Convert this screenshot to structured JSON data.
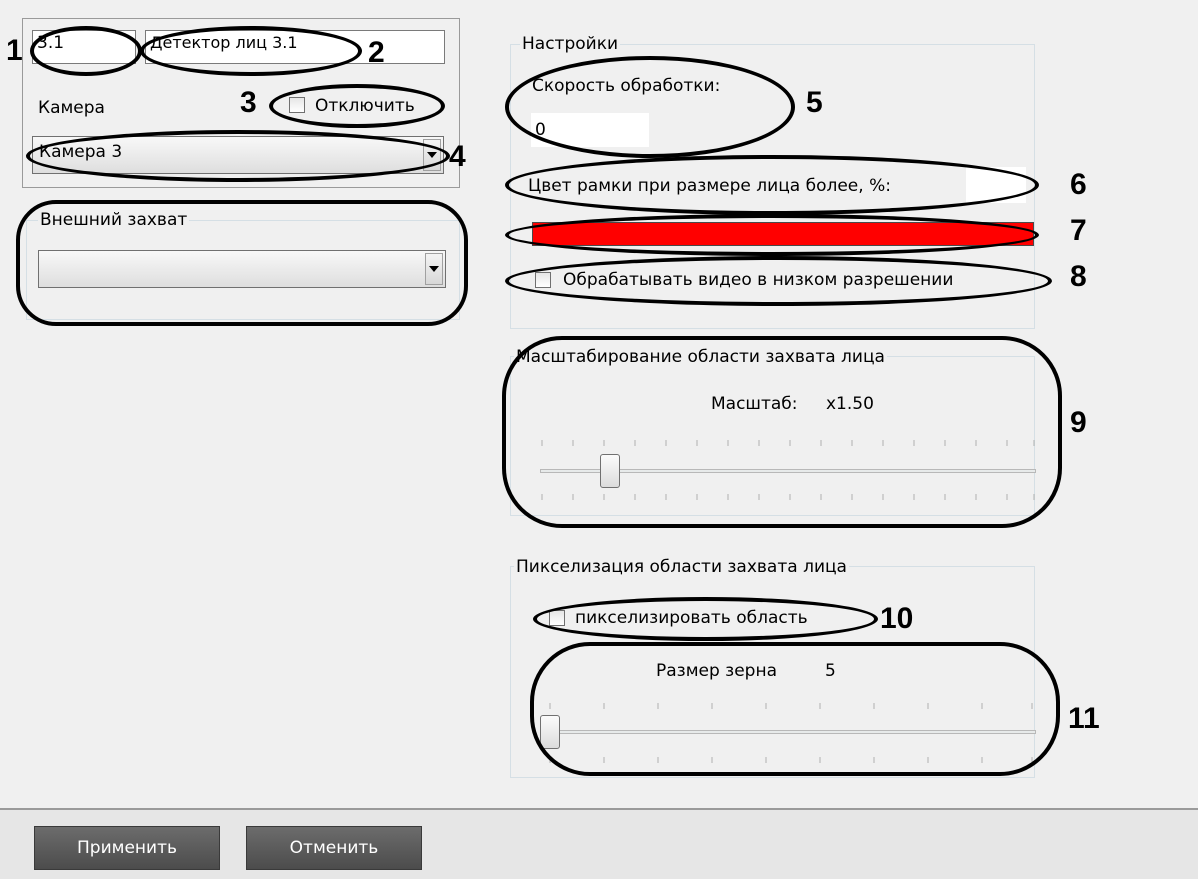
{
  "device": {
    "id_value": "3.1",
    "name_value": "Детектор лиц 3.1",
    "camera_label": "Камера",
    "disable_label": "Отключить",
    "camera_selected": "Камера 3"
  },
  "external_capture": {
    "legend": "Внешний захват",
    "selected": ""
  },
  "settings": {
    "legend": "Настройки",
    "speed_label": "Скорость обработки:",
    "speed_value": "0",
    "frame_color_label": "Цвет рамки при размере лица более, %:",
    "frame_percent_value": "",
    "color": "#ff0000",
    "low_res_label": "Обрабатывать видео в низком разрешении"
  },
  "scaling": {
    "legend": "Масштабирование области захвата лица",
    "scale_label": "Масштаб:",
    "scale_value": "x1.50"
  },
  "pixelization": {
    "legend": "Пикселизация области захвата лица",
    "checkbox_label": "пикселизировать область",
    "grain_label": "Размер зерна",
    "grain_value": "5"
  },
  "buttons": {
    "apply": "Применить",
    "cancel": "Отменить"
  },
  "callouts": [
    "1",
    "2",
    "3",
    "4",
    "5",
    "6",
    "7",
    "8",
    "9",
    "10",
    "11"
  ]
}
